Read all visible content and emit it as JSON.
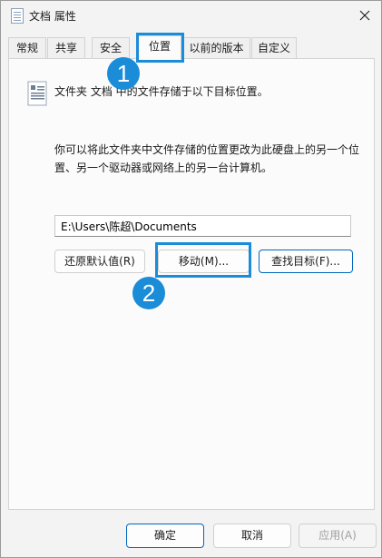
{
  "window": {
    "title": "文档 属性",
    "title_icon": "document-properties-icon",
    "close_icon": "close-icon"
  },
  "tabs": [
    {
      "label": "常规"
    },
    {
      "label": "共享"
    },
    {
      "label": "安全"
    },
    {
      "label": "位置",
      "active": true
    },
    {
      "label": "以前的版本"
    },
    {
      "label": "自定义"
    }
  ],
  "location": {
    "description": "文件夹 文档 中的文件存储于以下目标位置。",
    "info": "你可以将此文件夹中文件存储的位置更改为此硬盘上的另一个位置、另一个驱动器或网络上的另一台计算机。",
    "path_value": "E:\\Users\\陈超\\Documents",
    "restore_default_label": "还原默认值(R)",
    "move_label": "移动(M)...",
    "find_target_label": "查找目标(F)..."
  },
  "annotations": {
    "step1": "1",
    "step2": "2",
    "highlight_color": "#1a8cd8"
  },
  "footer": {
    "ok_label": "确定",
    "cancel_label": "取消",
    "apply_label": "应用(A)"
  }
}
